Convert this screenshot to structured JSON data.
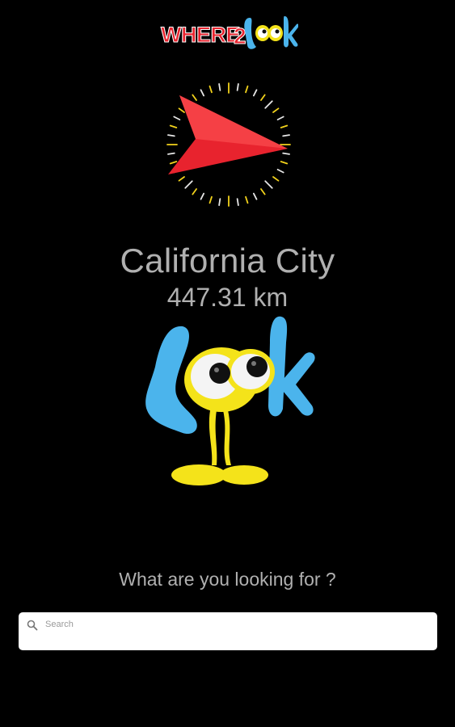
{
  "header": {
    "logo_text": "WHERE2Look",
    "logo_icon": "where2look-logo"
  },
  "compass": {
    "icon": "compass-arrow-icon",
    "arrow_color": "#e8232e",
    "tick_color": "#f2d21b"
  },
  "destination": {
    "name": "California City",
    "distance": "447.31 km"
  },
  "mascot": {
    "icon": "look-mascot-icon",
    "colors": {
      "blue": "#4bb4ec",
      "yellow": "#f4e31a"
    }
  },
  "search": {
    "prompt": "What are you looking for ?",
    "placeholder": "Search",
    "value": ""
  }
}
